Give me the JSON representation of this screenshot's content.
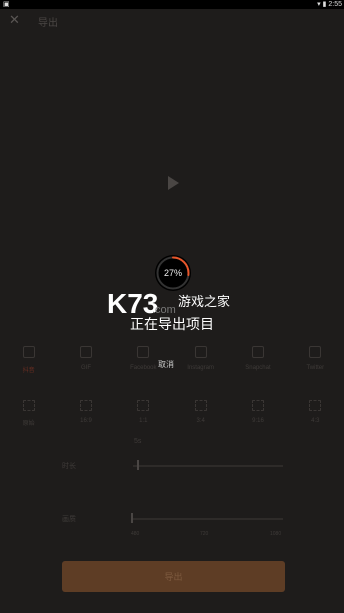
{
  "statusbar": {
    "time": "2:55",
    "icons": "▾ ▮"
  },
  "topbar": {
    "close_icon": "✕",
    "title": "导出"
  },
  "preview": {
    "play_icon": "play-icon"
  },
  "platforms": [
    {
      "label": "抖音",
      "icon": "edit-icon",
      "selected": true
    },
    {
      "label": "GIF",
      "icon": "gif-icon",
      "selected": false
    },
    {
      "label": "Facebook",
      "icon": "facebook-icon",
      "selected": false
    },
    {
      "label": "Instagram",
      "icon": "instagram-icon",
      "selected": false
    },
    {
      "label": "Snapchat",
      "icon": "snapchat-icon",
      "selected": false
    },
    {
      "label": "Twitter",
      "icon": "twitter-icon",
      "selected": false
    }
  ],
  "ratios": [
    {
      "label": "原始"
    },
    {
      "label": "16:9"
    },
    {
      "label": "1:1"
    },
    {
      "label": "3:4"
    },
    {
      "label": "9:16"
    },
    {
      "label": "4:3"
    }
  ],
  "duration": {
    "label": "时长",
    "value_label": "5s"
  },
  "resolution": {
    "label": "画质",
    "ticks": [
      "480",
      "720",
      "1080"
    ]
  },
  "export_button": {
    "label": "导出"
  },
  "progress": {
    "percent": 27,
    "percent_label": "27%"
  },
  "watermark": {
    "logo": "K73",
    "site": "游戏之家",
    "domain": ".com"
  },
  "export_status": "正在导出项目",
  "cancel_label": "取消",
  "colors": {
    "accent": "#e8562a",
    "button": "#5e3d25",
    "background": "#1e1c1b"
  }
}
